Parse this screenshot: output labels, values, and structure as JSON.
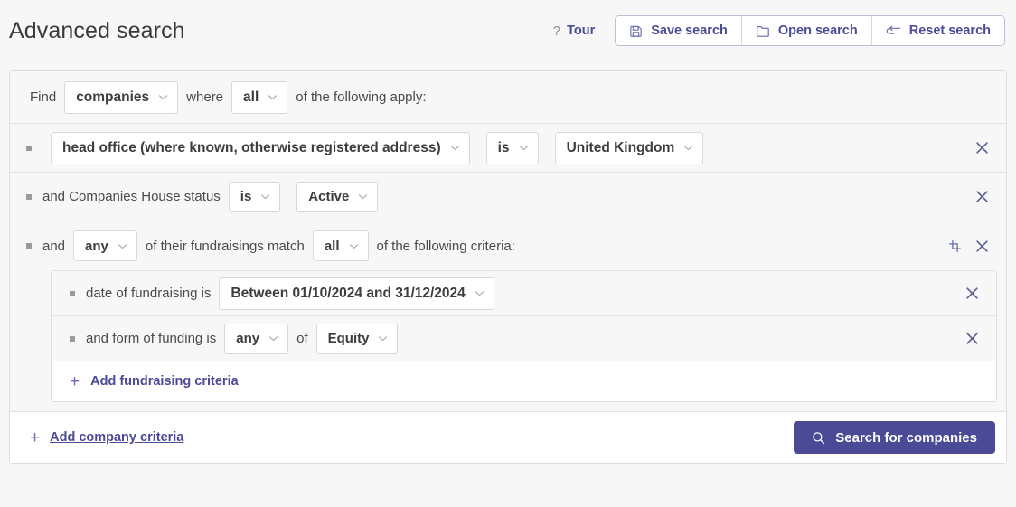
{
  "header": {
    "title": "Advanced search",
    "tour": {
      "icon": "question-icon",
      "label": "Tour"
    },
    "buttons": [
      {
        "icon": "save-disk-icon",
        "label": "Save search"
      },
      {
        "icon": "folder-icon",
        "label": "Open search"
      },
      {
        "icon": "reset-arrow-icon",
        "label": "Reset search"
      }
    ]
  },
  "query": {
    "find_row": {
      "find_label": "Find",
      "entity": "companies",
      "where_label": "where",
      "match": "all",
      "suffix_label": "of the following apply:"
    },
    "criteria": [
      {
        "field": "head office (where known, otherwise registered address)",
        "operator": "is",
        "value": "United Kingdom",
        "remove_icon": "close-icon"
      },
      {
        "prefix": "and Companies House status",
        "operator": "is",
        "value": "Active",
        "remove_icon": "close-icon"
      }
    ],
    "group": {
      "prefix": "and",
      "quantifier": "any",
      "middle_label": "of their fundraisings match",
      "match": "all",
      "suffix_label": "of the following criteria:",
      "duplicate_icon": "duplicate-icon",
      "remove_icon": "close-icon",
      "sub_criteria": [
        {
          "label": "date of fundraising is",
          "value": "Between 01/10/2024 and 31/12/2024",
          "remove_icon": "close-icon"
        },
        {
          "label": "and form of funding is",
          "quantifier": "any",
          "of_label": "of",
          "value": "Equity",
          "remove_icon": "close-icon"
        }
      ],
      "add_label": "Add fundraising criteria",
      "add_icon": "plus-icon"
    },
    "footer": {
      "add_label": "Add company criteria",
      "add_icon": "plus-icon",
      "search_label": "Search for companies",
      "search_icon": "search-icon"
    }
  },
  "colors": {
    "accent": "#4a4a97",
    "page_bg": "#f7f7f7",
    "row_bg": "#f7f7f7",
    "border": "#dcdcdc"
  }
}
